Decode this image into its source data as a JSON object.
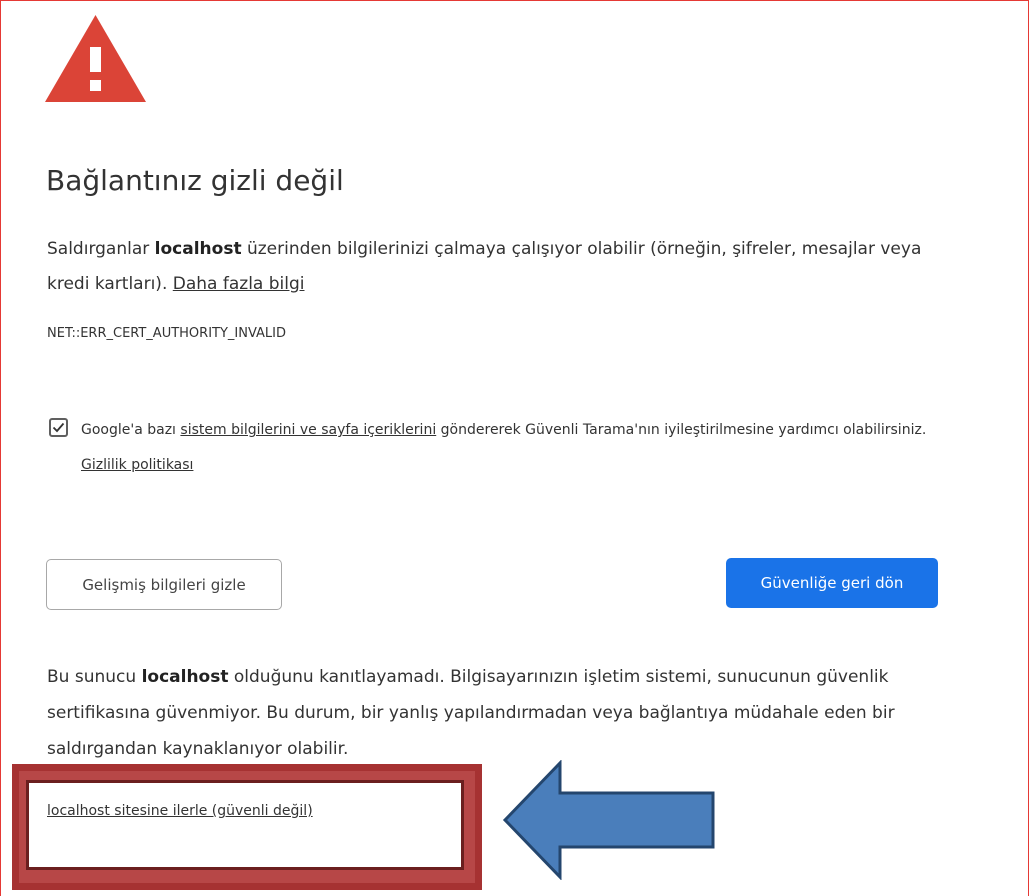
{
  "heading": "Bağlantınız gizli değil",
  "intro": {
    "prefix": "Saldırganlar",
    "host": "localhost",
    "middle": "üzerinden bilgilerinizi çalmaya çalışıyor olabilir (örneğin, şifreler, mesajlar veya kredi kartları).",
    "learn_more": "Daha fazla bilgi"
  },
  "error_code": "NET::ERR_CERT_AUTHORITY_INVALID",
  "optin": {
    "checked": true,
    "prefix": "Google'a bazı",
    "link": "sistem bilgilerini ve sayfa içeriklerini",
    "middle": "göndererek Güvenli Tarama'nın iyileştirilmesine yardımcı olabilirsiniz.",
    "privacy_link": "Gizlilik politikası"
  },
  "buttons": {
    "hide_advanced": "Gelişmiş bilgileri gizle",
    "back_to_safety": "Güvenliğe geri dön"
  },
  "explanation": {
    "prefix": "Bu sunucu",
    "host": "localhost",
    "rest": "olduğunu kanıtlayamadı. Bilgisayarınızın işletim sistemi, sunucunun güvenlik sertifikasına güvenmiyor. Bu durum, bir yanlış yapılandırmadan veya bağlantıya müdahale eden bir saldırgandan kaynaklanıyor olabilir."
  },
  "proceed_link": "localhost sitesine ilerle (güvenli değil)",
  "colors": {
    "warning_red": "#db4437",
    "primary_blue": "#1a73e8",
    "annotation_box": "#b74747",
    "annotation_arrow": "#4a7ebb"
  },
  "icons": {
    "warning": "warning-triangle-icon",
    "checkmark": "checkmark-icon",
    "annotation_arrow": "arrow-left-icon"
  }
}
